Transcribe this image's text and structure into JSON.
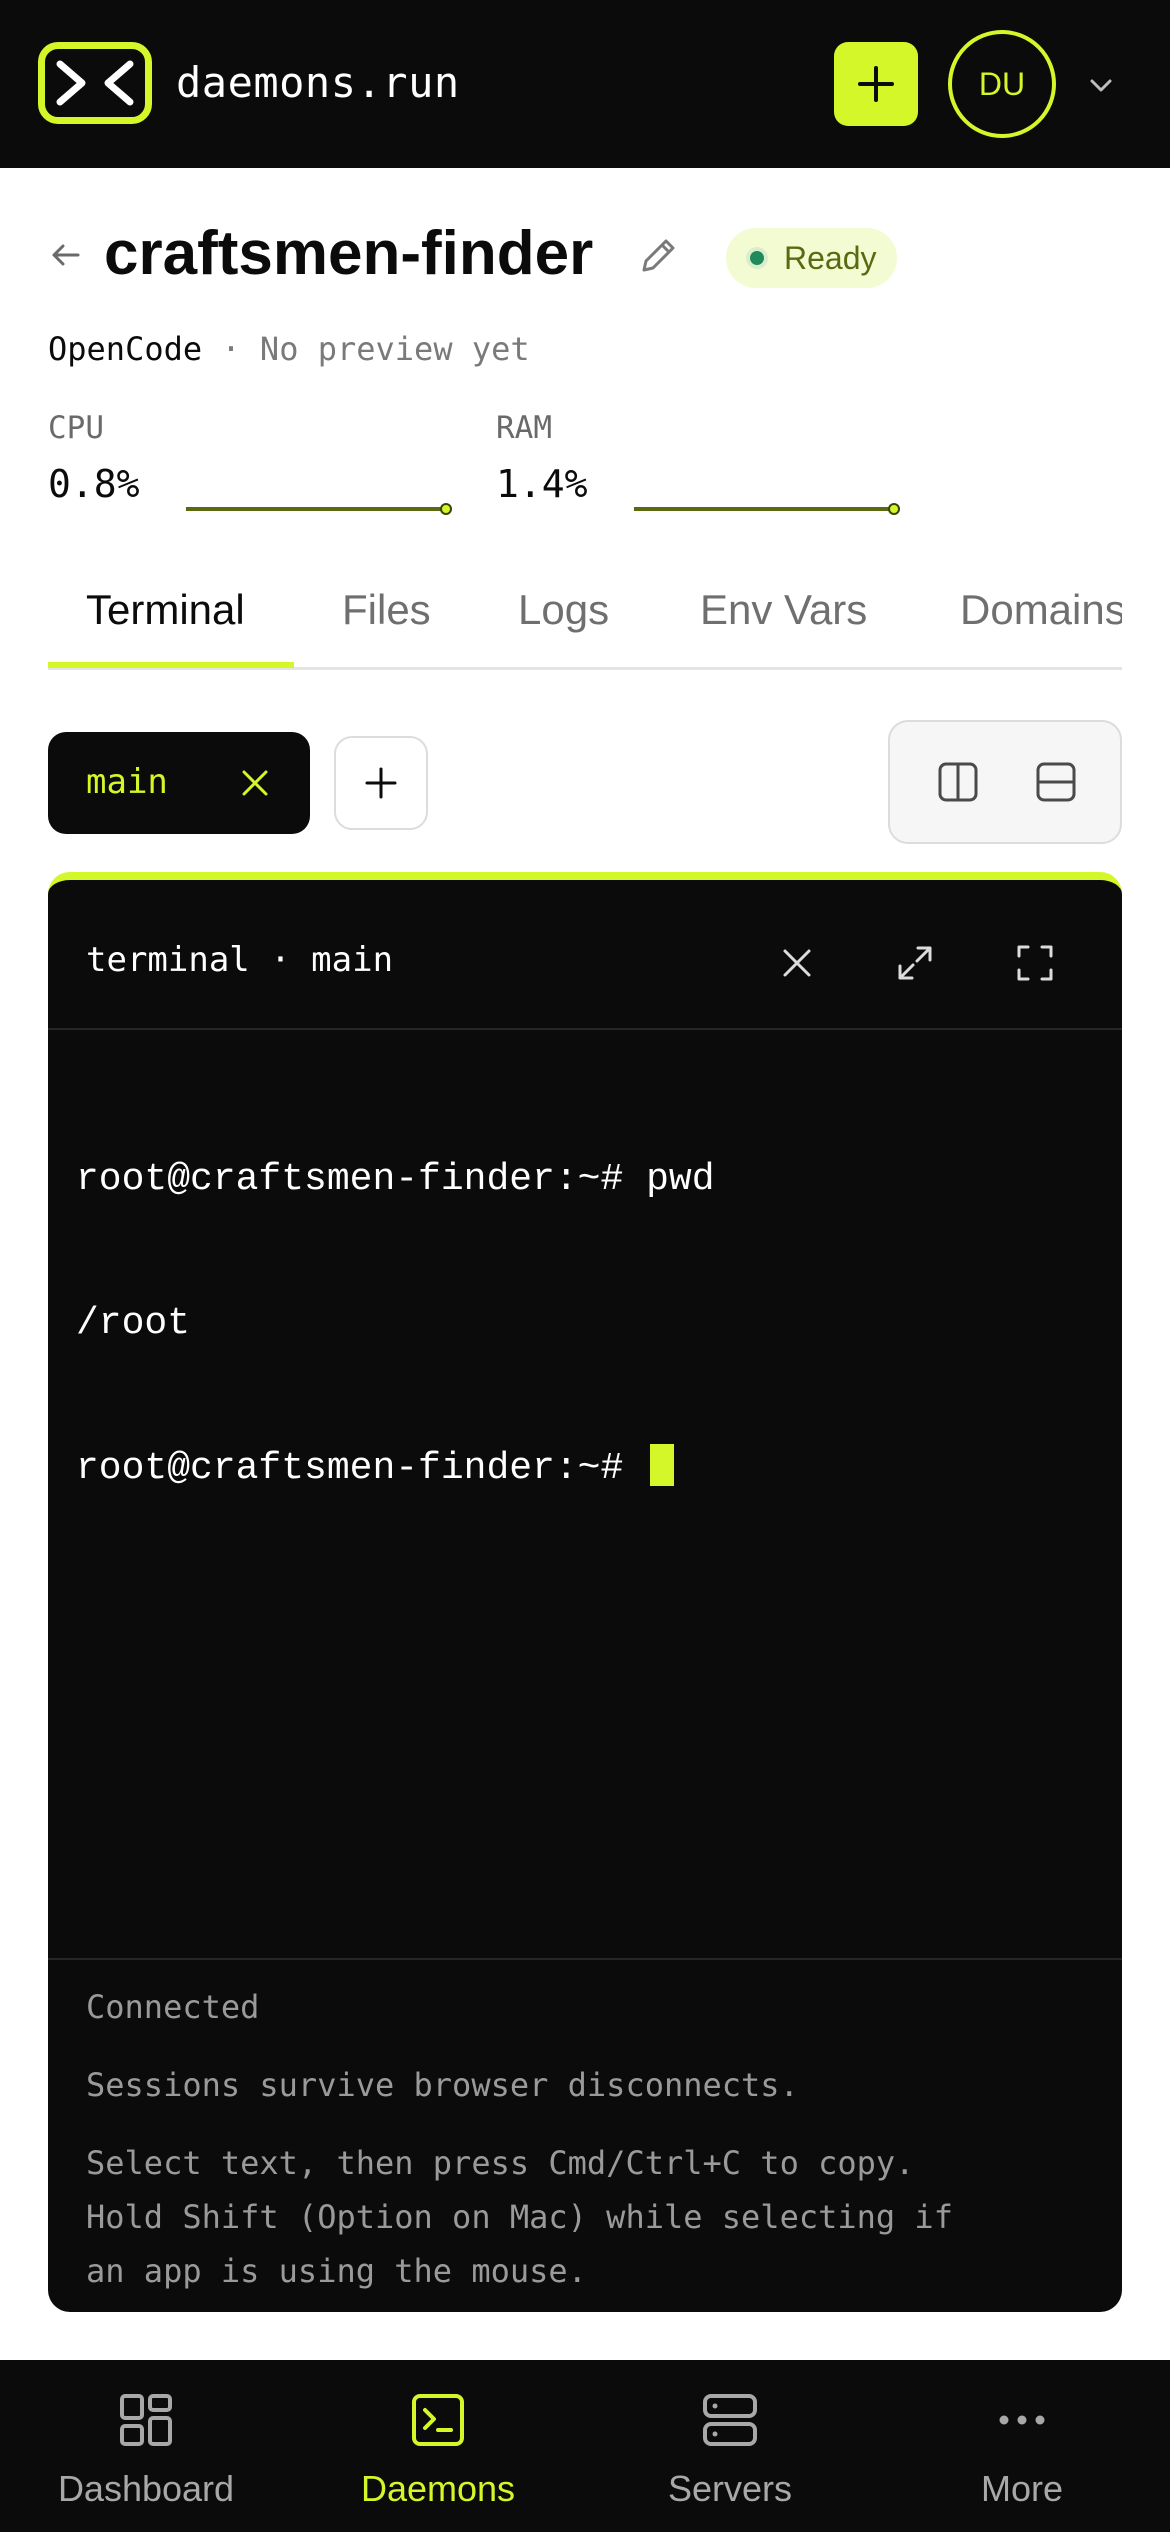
{
  "colors": {
    "accent": "#d4f72a",
    "dark": "#0b0b0b",
    "status_ready": "#1f8a5b"
  },
  "header": {
    "brand": "daemons.run",
    "logo_icon": "terminal-chevrons-icon",
    "add_icon": "plus-icon",
    "avatar_initials": "DU",
    "menu_icon": "chevron-down-icon"
  },
  "daemon": {
    "name": "craftsmen-finder",
    "status": "Ready",
    "agent": "OpenCode",
    "separator": " · ",
    "preview": "No preview yet"
  },
  "metrics": {
    "cpu": {
      "label": "CPU",
      "value": "0.8%",
      "level": 0.008
    },
    "ram": {
      "label": "RAM",
      "value": "1.4%",
      "level": 0.014
    }
  },
  "tabs": [
    {
      "label": "Terminal",
      "active": true
    },
    {
      "label": "Files",
      "active": false
    },
    {
      "label": "Logs",
      "active": false
    },
    {
      "label": "Env Vars",
      "active": false
    },
    {
      "label": "Domains",
      "active": false
    }
  ],
  "sessions": {
    "active": "main",
    "close_icon": "close-icon",
    "add_icon": "plus-icon",
    "layout_split_vertical_icon": "split-vertical-icon",
    "layout_split_horizontal_icon": "split-horizontal-icon"
  },
  "terminal": {
    "title": "terminal · main",
    "lines": [
      "root@craftsmen-finder:~# pwd",
      "/root",
      "root@craftsmen-finder:~# "
    ],
    "status": "Connected",
    "note1": "Sessions survive browser disconnects.",
    "note2_lines": [
      "Select text, then press Cmd/Ctrl+C to copy.",
      "Hold Shift (Option on Mac) while selecting if",
      "an app is using the mouse."
    ]
  },
  "bottom_nav": [
    {
      "label": "Dashboard",
      "icon": "dashboard-grid-icon",
      "active": false
    },
    {
      "label": "Daemons",
      "icon": "terminal-square-icon",
      "active": true
    },
    {
      "label": "Servers",
      "icon": "server-icon",
      "active": false
    },
    {
      "label": "More",
      "icon": "more-dots-icon",
      "active": false
    }
  ]
}
